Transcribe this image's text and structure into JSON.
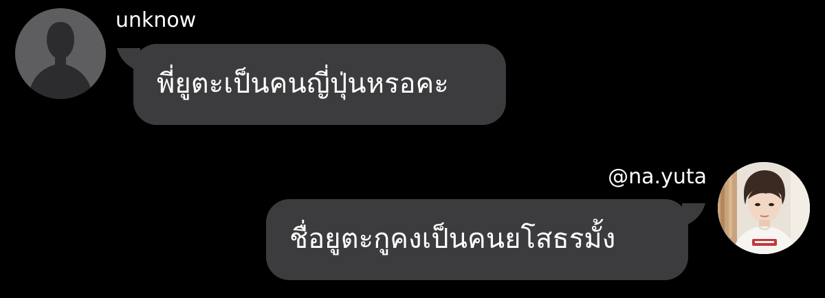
{
  "colors": {
    "background": "#000000",
    "bubble": "#3c3c3e",
    "text": "#ffffff",
    "default_avatar": "#5e5e60",
    "default_avatar_figure": "#2c2c2e"
  },
  "messages": [
    {
      "sender": "unknow",
      "text": "พี่ยูตะเป็นคนญี่ปุ่นหรอคะ",
      "side": "left",
      "avatar_icon": "default-person-icon"
    },
    {
      "sender": "@na.yuta",
      "text": "ชื่อยูตะกูคงเป็นคนยโสธรมั้ง",
      "side": "right",
      "avatar_icon": "profile-photo"
    }
  ]
}
